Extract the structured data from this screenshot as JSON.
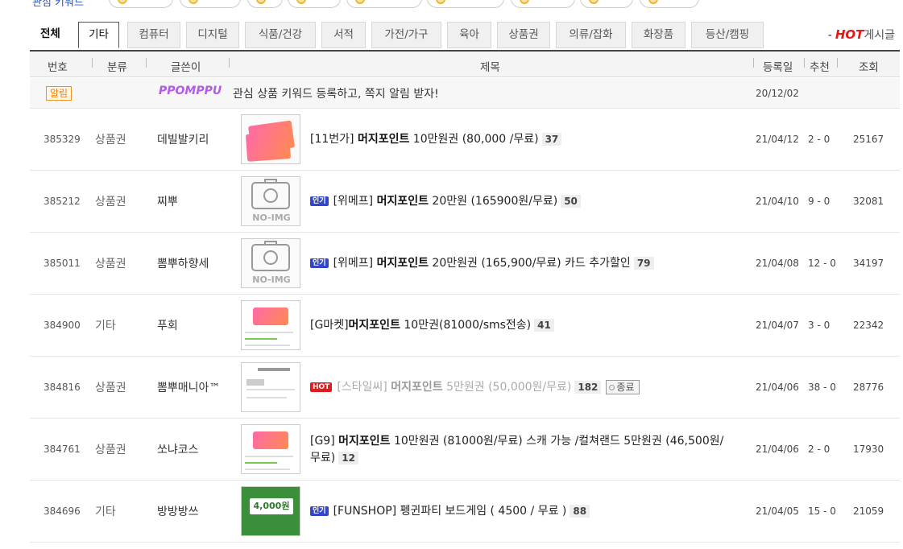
{
  "top_strip": {
    "label": "관심 키워드"
  },
  "tabs": [
    {
      "label": "전체",
      "state": "first"
    },
    {
      "label": "기타",
      "state": "active"
    },
    {
      "label": "컴퓨터",
      "state": "normal"
    },
    {
      "label": "디지털",
      "state": "normal"
    },
    {
      "label": "식품/건강",
      "state": "normal"
    },
    {
      "label": "서적",
      "state": "normal"
    },
    {
      "label": "가전/가구",
      "state": "normal"
    },
    {
      "label": "육아",
      "state": "normal"
    },
    {
      "label": "상품권",
      "state": "normal"
    },
    {
      "label": "의류/잡화",
      "state": "normal"
    },
    {
      "label": "화장품",
      "state": "normal"
    },
    {
      "label": "등산/캠핑",
      "state": "normal"
    }
  ],
  "hot_link": {
    "dash": "-",
    "hot": "HOT",
    "suffix": "게시글"
  },
  "columns": {
    "num": "번호",
    "category": "분류",
    "writer": "글쓴이",
    "title": "제목",
    "date": "등록일",
    "recommend": "추천",
    "views": "조회"
  },
  "notice": {
    "badge": "알림",
    "logo": "PPOMPPU",
    "text": "관심 상품 키워드 등록하고, 쪽지 알림 받자!",
    "date": "20/12/02"
  },
  "rows": [
    {
      "num": "385329",
      "category": "상품권",
      "writer": "데빌발키리",
      "thumb": "pink-cards",
      "badge": "",
      "pre": "[11번가] ",
      "bold": "머지포인트",
      "post": " 10만원권 (80,000 /무료)",
      "title_line2": "",
      "comments": "37",
      "ended": false,
      "end_label": "",
      "date": "21/04/12",
      "recommend": "2 - 0",
      "views": "25167"
    },
    {
      "num": "385212",
      "category": "상품권",
      "writer": "찌뿌",
      "thumb": "no-img",
      "badge": "인기",
      "pre": "[위메프] ",
      "bold": "머지포인트",
      "post": " 20만원 (165900원/무료)",
      "title_line2": "",
      "comments": "50",
      "ended": false,
      "end_label": "",
      "date": "21/04/10",
      "recommend": "9 - 0",
      "views": "32081"
    },
    {
      "num": "385011",
      "category": "상품권",
      "writer": "뽐뿌하향세",
      "thumb": "no-img",
      "badge": "인기",
      "pre": "[위메프] ",
      "bold": "머지포인트",
      "post": " 20만원권 (165,900/무료) 카드 추가할인",
      "title_line2": "",
      "comments": "79",
      "ended": false,
      "end_label": "",
      "date": "21/04/08",
      "recommend": "12 - 0",
      "views": "34197"
    },
    {
      "num": "384900",
      "category": "기타",
      "writer": "푸회",
      "thumb": "doc-card",
      "badge": "",
      "pre": "[G마켓]",
      "bold": "머지포인트",
      "post": " 10만권(81000/sms전송)",
      "title_line2": "",
      "comments": "41",
      "ended": false,
      "end_label": "",
      "date": "21/04/07",
      "recommend": "3 - 0",
      "views": "22342"
    },
    {
      "num": "384816",
      "category": "상품권",
      "writer": "뽐뿌매니아™",
      "thumb": "doc-plain",
      "badge": "HOT",
      "pre": "[스타일씨] ",
      "bold": "머지포인트",
      "post": " 5만원권 (50,000원/무료)",
      "title_line2": "",
      "comments": "182",
      "ended": true,
      "end_label": "종료",
      "date": "21/04/06",
      "recommend": "38 - 0",
      "views": "28776"
    },
    {
      "num": "384761",
      "category": "상품권",
      "writer": "쏘냐코스",
      "thumb": "doc-card2",
      "badge": "",
      "pre": "[G9] ",
      "bold": "머지포인트",
      "post": " 10만원권 (81000원/무료) 스캐 가능 /컬쳐랜드 5만원권 (46,500원/",
      "title_line2": "무료)",
      "comments": "12",
      "ended": false,
      "end_label": "",
      "date": "21/04/06",
      "recommend": "2 - 0",
      "views": "17930"
    },
    {
      "num": "384696",
      "category": "기타",
      "writer": "방방방쓰",
      "thumb": "green-coupon",
      "badge": "인기",
      "pre": "[FUNSHOP] 펭귄파티 보드게임 ( 4500 / 무료 )",
      "bold": "",
      "post": "",
      "title_line2": "",
      "comments": "88",
      "ended": false,
      "end_label": "",
      "date": "21/04/05",
      "recommend": "15 - 0",
      "views": "21059"
    }
  ],
  "thumb_text": {
    "no_img": "NO-IMG",
    "coupon": "4,000원"
  }
}
